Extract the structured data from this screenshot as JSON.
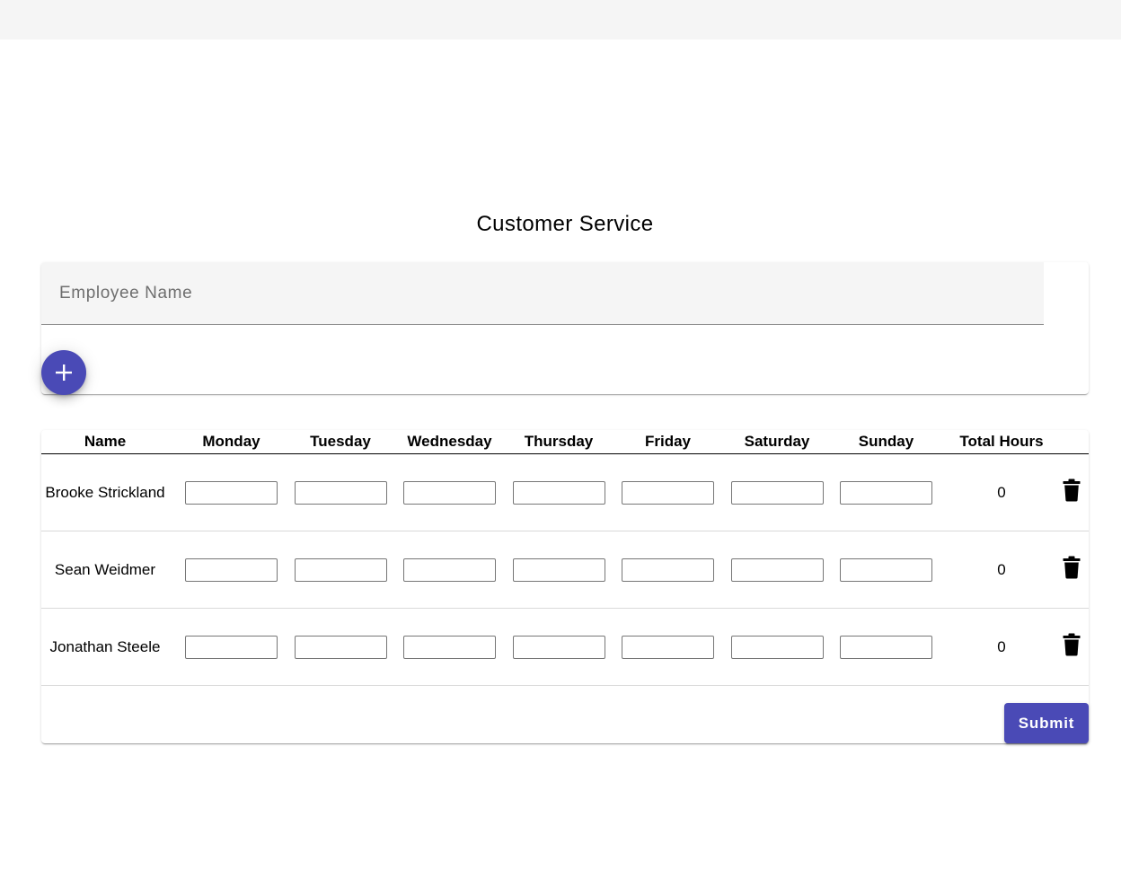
{
  "page": {
    "title": "Customer Service"
  },
  "add_employee": {
    "name_placeholder": "Employee Name",
    "name_value": "",
    "add_icon": "plus-icon"
  },
  "table": {
    "headers": [
      "Name",
      "Monday",
      "Tuesday",
      "Wednesday",
      "Thursday",
      "Friday",
      "Saturday",
      "Sunday",
      "Total Hours",
      ""
    ],
    "rows": [
      {
        "name": "Brooke Strickland",
        "hours": [
          "",
          "",
          "",
          "",
          "",
          "",
          ""
        ],
        "total": "0",
        "delete_icon": "trash-icon"
      },
      {
        "name": "Sean Weidmer",
        "hours": [
          "",
          "",
          "",
          "",
          "",
          "",
          ""
        ],
        "total": "0",
        "delete_icon": "trash-icon"
      },
      {
        "name": "Jonathan Steele",
        "hours": [
          "",
          "",
          "",
          "",
          "",
          "",
          ""
        ],
        "total": "0",
        "delete_icon": "trash-icon"
      }
    ]
  },
  "actions": {
    "submit_label": "Submit"
  },
  "colors": {
    "primary": "#4a4ab6",
    "top_bar": "#f5f5f5",
    "field_background": "#f5f5f5"
  }
}
